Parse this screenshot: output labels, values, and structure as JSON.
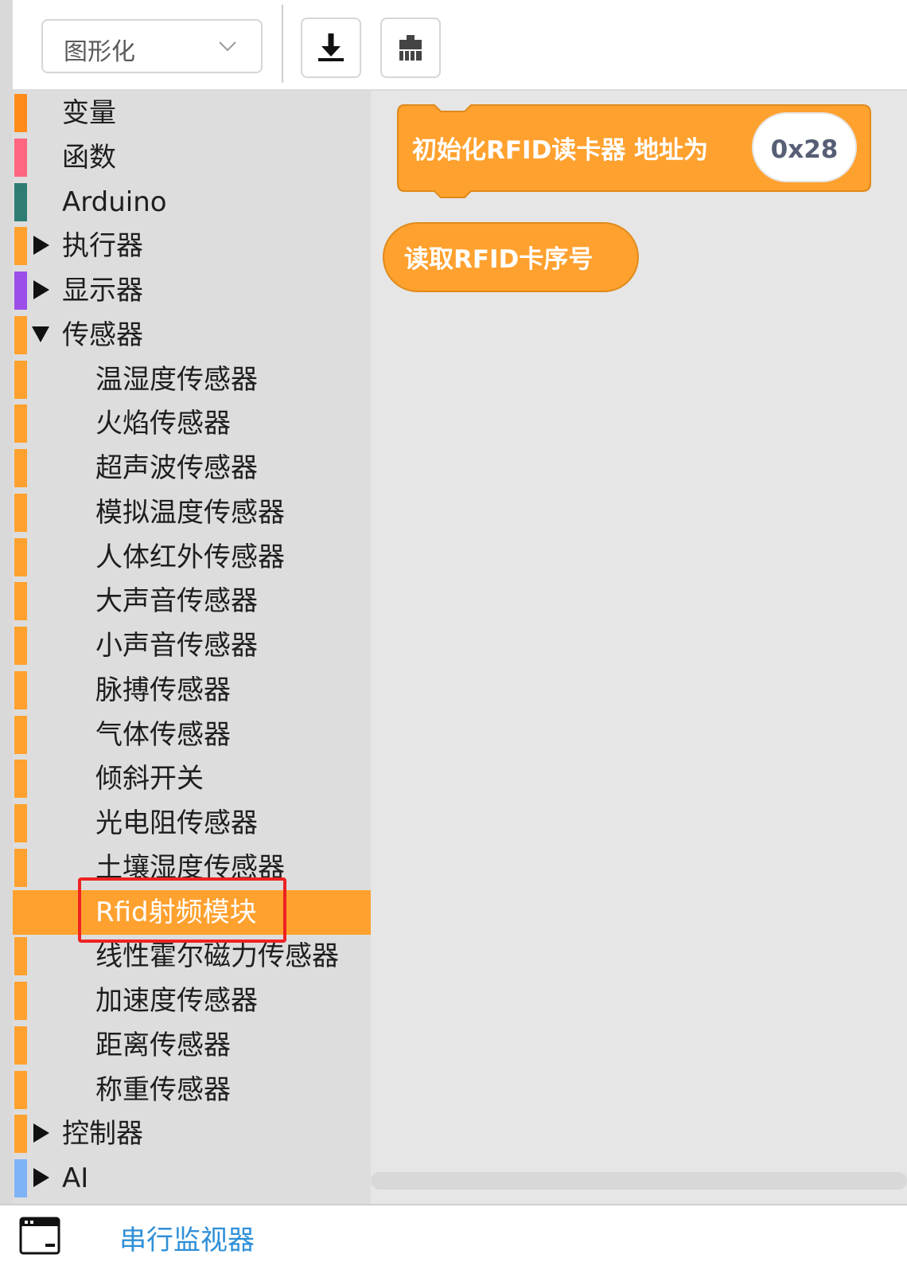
{
  "toolbar": {
    "mode_select": {
      "value": "图形化",
      "icon": "chevron-down-icon"
    },
    "buttons": [
      {
        "name": "download-button",
        "icon": "download-icon"
      },
      {
        "name": "plugin-button",
        "icon": "plugin-icon"
      }
    ]
  },
  "sidebar": {
    "items": [
      {
        "label": "变量",
        "color": "#ff8c1a",
        "level": 0,
        "arrow": "none"
      },
      {
        "label": "函数",
        "color": "#ff6680",
        "level": 0,
        "arrow": "none"
      },
      {
        "label": "Arduino",
        "color": "#2e7d73",
        "level": 0,
        "arrow": "none"
      },
      {
        "label": "执行器",
        "color": "#ffa12f",
        "level": 0,
        "arrow": "collapsed"
      },
      {
        "label": "显示器",
        "color": "#9b4fe8",
        "level": 0,
        "arrow": "collapsed"
      },
      {
        "label": "传感器",
        "color": "#ffa12f",
        "level": 0,
        "arrow": "expanded"
      },
      {
        "label": "温湿度传感器",
        "color": "#ffa12f",
        "level": 1,
        "arrow": "none"
      },
      {
        "label": "火焰传感器",
        "color": "#ffa12f",
        "level": 1,
        "arrow": "none"
      },
      {
        "label": "超声波传感器",
        "color": "#ffa12f",
        "level": 1,
        "arrow": "none"
      },
      {
        "label": "模拟温度传感器",
        "color": "#ffa12f",
        "level": 1,
        "arrow": "none"
      },
      {
        "label": "人体红外传感器",
        "color": "#ffa12f",
        "level": 1,
        "arrow": "none"
      },
      {
        "label": "大声音传感器",
        "color": "#ffa12f",
        "level": 1,
        "arrow": "none"
      },
      {
        "label": "小声音传感器",
        "color": "#ffa12f",
        "level": 1,
        "arrow": "none"
      },
      {
        "label": "脉搏传感器",
        "color": "#ffa12f",
        "level": 1,
        "arrow": "none"
      },
      {
        "label": "气体传感器",
        "color": "#ffa12f",
        "level": 1,
        "arrow": "none"
      },
      {
        "label": "倾斜开关",
        "color": "#ffa12f",
        "level": 1,
        "arrow": "none"
      },
      {
        "label": "光电阻传感器",
        "color": "#ffa12f",
        "level": 1,
        "arrow": "none"
      },
      {
        "label": "土壤湿度传感器",
        "color": "#ffa12f",
        "level": 1,
        "arrow": "none"
      },
      {
        "label": "Rfid射频模块",
        "color": "#ffa12f",
        "level": 1,
        "arrow": "none",
        "selected": true
      },
      {
        "label": "线性霍尔磁力传感器",
        "color": "#ffa12f",
        "level": 1,
        "arrow": "none"
      },
      {
        "label": "加速度传感器",
        "color": "#ffa12f",
        "level": 1,
        "arrow": "none"
      },
      {
        "label": "距离传感器",
        "color": "#ffa12f",
        "level": 1,
        "arrow": "none"
      },
      {
        "label": "称重传感器",
        "color": "#ffa12f",
        "level": 1,
        "arrow": "none"
      },
      {
        "label": "控制器",
        "color": "#ffa12f",
        "level": 0,
        "arrow": "collapsed"
      },
      {
        "label": "AI",
        "color": "#7fb3f5",
        "level": 0,
        "arrow": "collapsed"
      }
    ]
  },
  "blocks": {
    "init_rfid": {
      "text": "初始化RFID读卡器 地址为",
      "address": "0x28",
      "color": "#ffa12f",
      "border": "#e08a1a"
    },
    "read_rfid": {
      "text": "读取RFID卡序号",
      "color": "#ffa12f",
      "border": "#e08a1a"
    }
  },
  "bottom_bar": {
    "serial_monitor_label": "串行监视器",
    "icon": "serial-monitor-icon",
    "label_color": "#2f8fd8"
  },
  "colors": {
    "accent": "#ffa12f",
    "highlight": "#ee2222"
  }
}
